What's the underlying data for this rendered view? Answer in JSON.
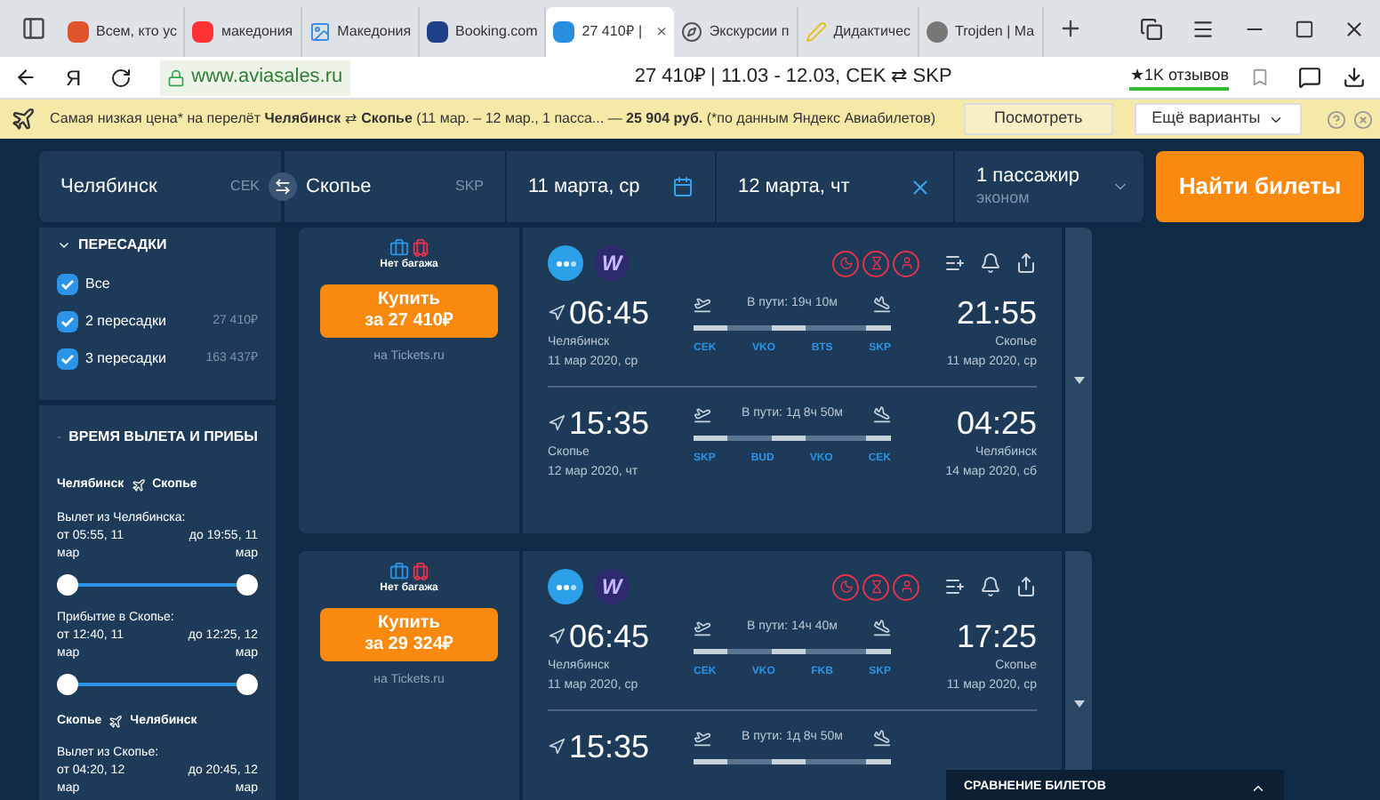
{
  "browser": {
    "tabs": [
      {
        "label": "Всем, кто ус",
        "selected": false
      },
      {
        "label": "македония",
        "selected": false
      },
      {
        "label": "Македония",
        "selected": false
      },
      {
        "label": "Booking.com",
        "selected": false
      },
      {
        "label": "27 410₽ |",
        "selected": true,
        "close": "×"
      },
      {
        "label": "Экскурсии п",
        "selected": false
      },
      {
        "label": "Дидактичес",
        "selected": false
      },
      {
        "label": "Trojden | Ma",
        "selected": false
      }
    ],
    "ya_logo": "Я",
    "url": "www.aviasales.ru",
    "page_title": "27 410₽ | 11.03 - 12.03, CEK ⇄ SKP",
    "reviews": "★1K отзывов"
  },
  "info_bar": {
    "text": "Самая низкая цена* на перелёт **Челябинск** ⇄ **Скопье** (11 мар. – 12 мар., 1 пасса... — **25 904 руб.** (*по данным Яндекс Авиабилетов)",
    "view_button": "Посмотреть",
    "more_button": "Ещё варианты"
  },
  "search": {
    "from": {
      "city": "Челябинск",
      "code": "CEK"
    },
    "to": {
      "city": "Скопье",
      "code": "SKP"
    },
    "depart": "11 марта, ср",
    "return": "12 марта, чт",
    "passengers": "1 пассажир",
    "cabin": "эконом",
    "submit": "Найти билеты"
  },
  "filters": {
    "transfers": {
      "title": "ПЕРЕСАДКИ",
      "expanded": true,
      "options": [
        {
          "label": "Все",
          "checked": true
        },
        {
          "label": "2 пересадки",
          "price": "27 410₽",
          "checked": true
        },
        {
          "label": "3 пересадки",
          "price": "163 437₽",
          "checked": true
        }
      ]
    },
    "times": {
      "title": "ВРЕМЯ ВЫЛЕТА И ПРИБЫ",
      "expanded": true,
      "routes": [
        {
          "from": "Челябинск",
          "to": "Скопье",
          "sliders": [
            {
              "label": "Вылет из Челябинска:",
              "min": "от 05:55, 11 мар",
              "max": "до 19:55, 11 мар",
              "level": 1
            },
            {
              "label": "Прибытие в Скопье:",
              "min": "от 12:40, 11 мар",
              "max": "до 12:25, 12 мар",
              "level": 1
            }
          ]
        },
        {
          "from": "Скопье",
          "to": "Челябинск",
          "sliders": [
            {
              "label": "Вылет из Скопье:",
              "min": "от 04:20, 12 мар",
              "max": "до 20:45, 12 мар"
            }
          ]
        }
      ]
    }
  },
  "tickets": [
    {
      "baggage": "Нет багажа",
      "buy": "Купить",
      "price": "за 27 410₽",
      "seller": "на Tickets.ru",
      "airline_letter": "W",
      "legs": [
        {
          "depart_time": "06:45",
          "depart_city": "Челябинск",
          "depart_date": "11 мар 2020, ср",
          "duration": "В пути: 19ч 10м",
          "airports": [
            "CEK",
            "VKO",
            "BTS",
            "SKP"
          ],
          "arrive_time": "21:55",
          "arrive_city": "Скопье",
          "arrive_date": "11 мар 2020, ср"
        },
        {
          "depart_time": "15:35",
          "depart_city": "Скопье",
          "depart_date": "12 мар 2020, чт",
          "duration": "В пути: 1д 8ч 50м",
          "airports": [
            "SKP",
            "BUD",
            "VKO",
            "CEK"
          ],
          "arrive_time": "04:25",
          "arrive_city": "Челябинск",
          "arrive_date": "14 мар 2020, сб"
        }
      ]
    },
    {
      "baggage": "Нет багажа",
      "buy": "Купить",
      "price": "за 29 324₽",
      "seller": "на Tickets.ru",
      "airline_letter": "W",
      "legs": [
        {
          "depart_time": "06:45",
          "depart_city": "Челябинск",
          "depart_date": "11 мар 2020, ср",
          "duration": "В пути: 14ч 40м",
          "airports": [
            "CEK",
            "VKO",
            "FKB",
            "SKP"
          ],
          "arrive_time": "17:25",
          "arrive_city": "Скопье",
          "arrive_date": "11 мар 2020, ср"
        },
        {
          "depart_time": "15:35",
          "duration": "В пути: 1д 8ч 50м"
        }
      ]
    }
  ],
  "compare_panel": {
    "title": "СРАВНЕНИЕ БИЛЕТОВ",
    "expanded": false
  }
}
